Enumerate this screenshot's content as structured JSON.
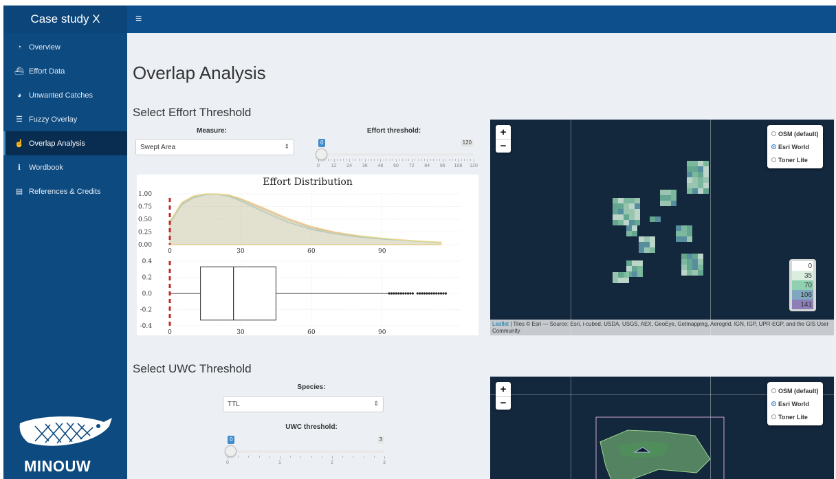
{
  "sidebar": {
    "title": "Case study X",
    "items": [
      {
        "label": "Overview",
        "icon": "dashboard-icon"
      },
      {
        "label": "Effort Data",
        "icon": "ship-icon"
      },
      {
        "label": "Unwanted Catches",
        "icon": "pie-chart-icon"
      },
      {
        "label": "Fuzzy Overlay",
        "icon": "layers-icon"
      },
      {
        "label": "Overlap Analysis",
        "icon": "hand-pointer-icon"
      },
      {
        "label": "Wordbook",
        "icon": "info-icon"
      },
      {
        "label": "References & Credits",
        "icon": "book-icon"
      }
    ],
    "active_index": 4,
    "logo_text": "MINOUW"
  },
  "header": {
    "menu_icon": "hamburger-icon"
  },
  "main": {
    "title": "Overlap Analysis",
    "effort": {
      "section_title": "Select Effort Threshold",
      "measure_label": "Measure:",
      "measure_value": "Swept Area",
      "threshold_label": "Effort threshold:",
      "slider": {
        "min": 0,
        "max": 120,
        "value": 0,
        "ticks": [
          "0",
          "12",
          "24",
          "36",
          "48",
          "60",
          "72",
          "84",
          "96",
          "108",
          "120"
        ]
      },
      "plot_title": "Effort Distribution"
    },
    "uwc": {
      "section_title": "Select UWC Threshold",
      "species_label": "Species:",
      "species_value": "TTL",
      "threshold_label": "UWC threshold:",
      "slider": {
        "min": 0,
        "max": 3,
        "value": 0,
        "ticks": [
          "0",
          "1",
          "2",
          "3"
        ]
      }
    }
  },
  "map1": {
    "layers": [
      {
        "label": "OSM (default)",
        "selected": false
      },
      {
        "label": "Esri World",
        "selected": true
      },
      {
        "label": "Toner Lite",
        "selected": false
      }
    ],
    "legend": [
      {
        "label": "0",
        "color": "#ffffff"
      },
      {
        "label": "35",
        "color": "#d9eedf"
      },
      {
        "label": "70",
        "color": "#8ed0b0"
      },
      {
        "label": "106",
        "color": "#7fa7bf"
      },
      {
        "label": "141",
        "color": "#8e7fb8"
      }
    ],
    "attribution_link": "Leaflet",
    "attribution": "| Tiles © Esri — Source: Esri, i-cubed, USDA, USGS, AEX, GeoEye, Getmapping, Aerogrid, IGN, IGP, UPR-EGP, and the GIS User Community"
  },
  "map2": {
    "layers": [
      {
        "label": "OSM (default)",
        "selected": false
      },
      {
        "label": "Esri World",
        "selected": true
      },
      {
        "label": "Toner Lite",
        "selected": false
      }
    ]
  },
  "chart_data": [
    {
      "type": "area",
      "title": "Effort Distribution",
      "xlim": [
        0,
        123
      ],
      "ylim": [
        0,
        1
      ],
      "x_ticks": [
        "0",
        "30",
        "60",
        "90"
      ],
      "y_ticks": [
        "0.00",
        "0.25",
        "0.50",
        "0.75",
        "1.00"
      ],
      "threshold_marker": 0,
      "x": [
        0,
        5,
        10,
        15,
        20,
        25,
        30,
        40,
        50,
        60,
        70,
        80,
        90,
        100,
        110,
        115
      ],
      "series": [
        {
          "color": "#e0a0a0",
          "values": [
            0.45,
            0.82,
            0.95,
            0.99,
            1.0,
            0.97,
            0.9,
            0.7,
            0.5,
            0.34,
            0.24,
            0.17,
            0.12,
            0.09,
            0.06,
            0.05
          ]
        },
        {
          "color": "#9fb8d8",
          "values": [
            0.42,
            0.78,
            0.92,
            0.98,
            0.99,
            0.95,
            0.86,
            0.64,
            0.44,
            0.3,
            0.21,
            0.15,
            0.11,
            0.08,
            0.05,
            0.04
          ]
        },
        {
          "color": "#b8d8a0",
          "values": [
            0.44,
            0.8,
            0.94,
            0.99,
            0.99,
            0.96,
            0.88,
            0.67,
            0.47,
            0.32,
            0.22,
            0.16,
            0.12,
            0.08,
            0.05,
            0.04
          ]
        },
        {
          "color": "#f0d890",
          "values": [
            0.46,
            0.83,
            0.96,
            1.0,
            1.0,
            0.98,
            0.91,
            0.72,
            0.52,
            0.36,
            0.25,
            0.18,
            0.13,
            0.09,
            0.06,
            0.05
          ]
        }
      ]
    },
    {
      "type": "box",
      "xlim": [
        0,
        123
      ],
      "ylim": [
        -0.4,
        0.4
      ],
      "x_ticks": [
        "0",
        "30",
        "60",
        "90"
      ],
      "y_ticks": [
        "-0.4",
        "-0.2",
        "0.0",
        "0.2",
        "0.4"
      ],
      "threshold_marker": 0,
      "min": 0,
      "q1": 13,
      "median": 27,
      "q3": 45,
      "whisker_high": 93,
      "outliers": [
        93,
        94,
        95,
        96,
        97,
        98,
        99,
        100,
        101,
        102,
        103,
        105,
        106,
        107,
        108,
        109,
        110,
        111,
        112,
        113,
        114,
        115,
        116,
        117
      ]
    }
  ]
}
